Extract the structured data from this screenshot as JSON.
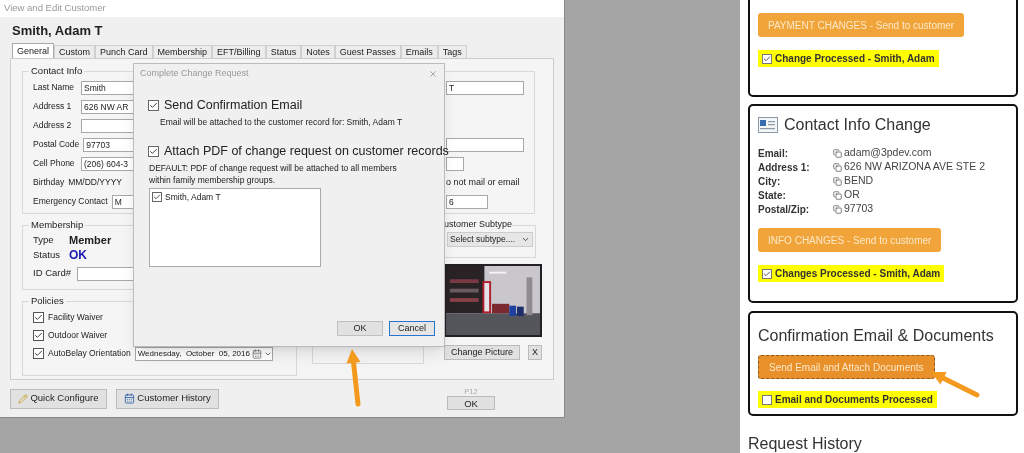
{
  "window": {
    "title": "View and Edit Customer",
    "customer_name": "Smith, Adam T",
    "tabs": [
      {
        "label": "General",
        "selected": true
      },
      {
        "label": "Custom",
        "selected": false
      },
      {
        "label": "Punch Card",
        "selected": false
      },
      {
        "label": "Membership",
        "selected": false
      },
      {
        "label": "EFT/Billing",
        "selected": false
      },
      {
        "label": "Status",
        "selected": false
      },
      {
        "label": "Notes",
        "selected": false
      },
      {
        "label": "Guest Passes",
        "selected": false
      },
      {
        "label": "Emails",
        "selected": false
      },
      {
        "label": "Tags",
        "selected": false
      }
    ],
    "contact_info": {
      "legend": "Contact Info",
      "rows": [
        {
          "label": "Last Name",
          "kind": "input",
          "value": "Smith",
          "right": {
            "kind": "input",
            "value": "T"
          }
        },
        {
          "label": "Address 1",
          "kind": "input",
          "value": "626 NW AR"
        },
        {
          "label": "Address 2",
          "kind": "input"
        },
        {
          "label": "Postal Code",
          "kind": "input",
          "value": "97703",
          "right": {
            "kind": "input"
          }
        },
        {
          "label": "Cell Phone",
          "kind": "input",
          "value": "(206) 604-3",
          "right": {
            "kind": "short_input"
          }
        },
        {
          "label": "Birthday",
          "kind": "text",
          "value": "MM/DD/YYYY",
          "right": {
            "kind": "text",
            "value": "o not mail or email"
          }
        },
        {
          "label": "Emergency Contact",
          "kind": "input",
          "value": "M",
          "right": {
            "kind": "medium_input",
            "value": "6"
          }
        }
      ]
    },
    "membership": {
      "legend": "Membership",
      "type_label": "Type",
      "type": "Member",
      "status_label": "Status",
      "status": "OK",
      "id_label": "ID Card#"
    },
    "policies": {
      "legend": "Policies",
      "items": [
        {
          "label": "Facility Waiver",
          "checked": true
        },
        {
          "label": "Outdoor Waiver",
          "checked": true
        },
        {
          "label": "AutoBelay Orientation",
          "checked": true,
          "date": "Wednesday,  October  05, 2016"
        }
      ]
    },
    "subtype": {
      "legend": "ustomer Subtype",
      "value": "Select subtype...."
    },
    "photo": {
      "kind": "picture"
    },
    "photo_buttons": [
      "Change Picture",
      "X"
    ],
    "bottom_buttons": [
      "Quick Configure",
      "Customer History"
    ],
    "ok_hint": "P12",
    "ok": "OK"
  },
  "dialog": {
    "title": "Complete Change Request",
    "options": [
      {
        "label": "Send Confirmation Email",
        "checked": true,
        "note": "Email will be attached to the customer record for: Smith, Adam T"
      },
      {
        "label": "Attach PDF of change request on customer records",
        "checked": true,
        "note": "DEFAULT:  PDF of change request will be attached to all members within family membership groups."
      }
    ],
    "members": [
      {
        "name": "Smith, Adam T",
        "checked": true
      }
    ],
    "buttons": [
      {
        "label": "OK",
        "focused": false
      },
      {
        "label": "Cancel",
        "focused": true
      }
    ]
  },
  "request_panel": {
    "cards": [
      {
        "button": "PAYMENT CHANGES - Send to customer",
        "button_focused": false,
        "check": {
          "label": "Change Processed - Smith, Adam",
          "checked": true
        }
      },
      {
        "title": "Contact Info Change",
        "fields": [
          {
            "label": "Email:",
            "value": "adam@3pdev.com"
          },
          {
            "label": "Address 1:",
            "value": "626 NW ARIZONA AVE STE 2"
          },
          {
            "label": "City:",
            "value": "BEND"
          },
          {
            "label": "State:",
            "value": "OR"
          },
          {
            "label": "Postal/Zip:",
            "value": "97703"
          }
        ],
        "button": "INFO CHANGES - Send to customer",
        "button_focused": false,
        "check": {
          "label": "Changes Processed - Smith, Adam",
          "checked": true
        }
      },
      {
        "title": "Confirmation Email & Documents",
        "button": "Send Email and Attach Documents",
        "button_focused": true,
        "check": {
          "label": "Email and Documents Processed",
          "checked": false
        }
      }
    ],
    "history_title": "Request History"
  }
}
